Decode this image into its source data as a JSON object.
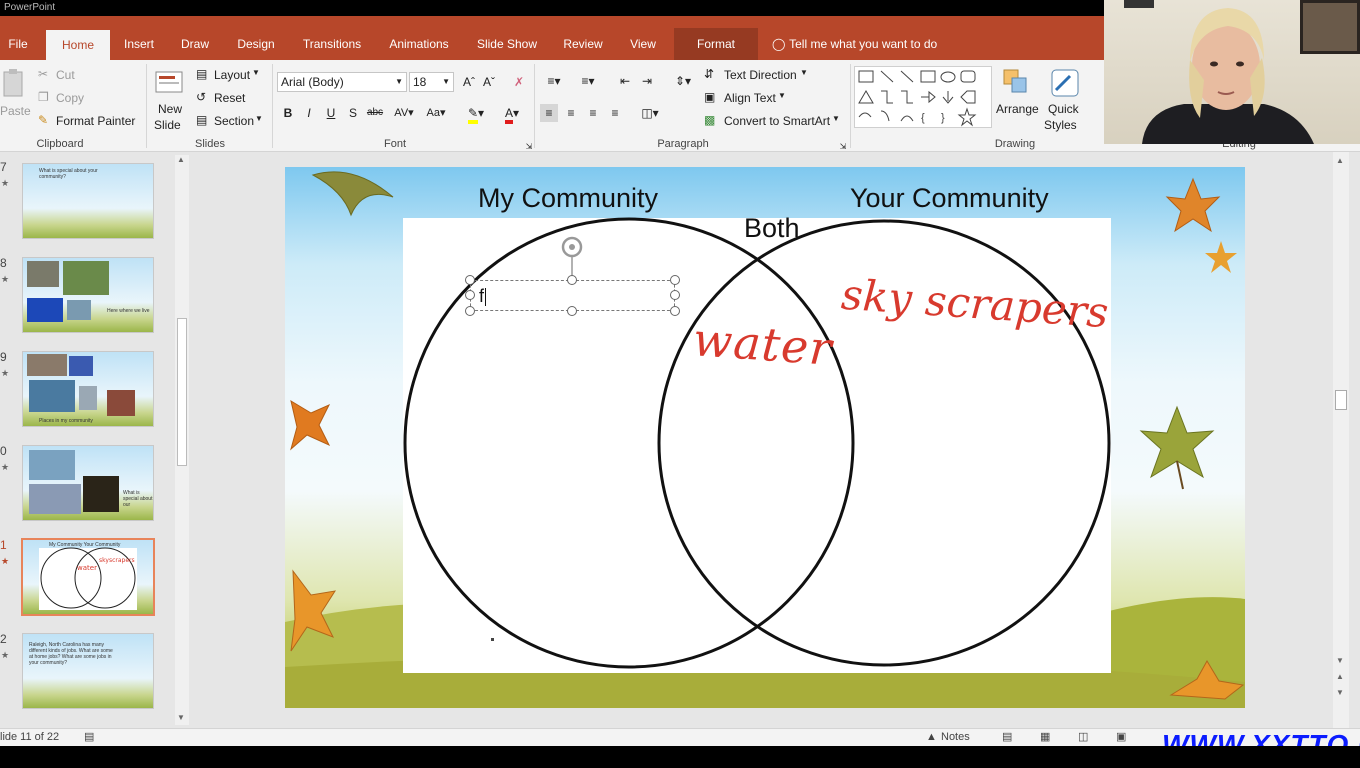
{
  "window": {
    "title_fragment": "PowerPoint"
  },
  "tabs": [
    {
      "label": "File"
    },
    {
      "label": "Home"
    },
    {
      "label": "Insert"
    },
    {
      "label": "Draw"
    },
    {
      "label": "Design"
    },
    {
      "label": "Transitions"
    },
    {
      "label": "Animations"
    },
    {
      "label": "Slide Show"
    },
    {
      "label": "Review"
    },
    {
      "label": "View"
    },
    {
      "label": "Format"
    }
  ],
  "tell_me": "Tell me what you want to do",
  "ribbon": {
    "clipboard": {
      "paste": "Paste",
      "cut": "Cut",
      "copy": "Copy",
      "format_painter": "Format Painter",
      "group": "Clipboard"
    },
    "slides": {
      "new_slide": "New",
      "new_slide2": "Slide",
      "layout": "Layout",
      "reset": "Reset",
      "section": "Section",
      "group": "Slides"
    },
    "font": {
      "family": "Arial (Body)",
      "size": "18",
      "group": "Font"
    },
    "paragraph": {
      "text_direction": "Text Direction",
      "align_text": "Align Text",
      "convert_smartart": "Convert to SmartArt",
      "group": "Paragraph"
    },
    "drawing": {
      "arrange": "Arrange",
      "quick_styles": "Quick",
      "quick_styles2": "Styles",
      "group": "Drawing"
    },
    "editing": {
      "group": "Editing"
    }
  },
  "thumbnails": [
    {
      "num": "7",
      "text": "What is special about your community?"
    },
    {
      "num": "8",
      "text": "Here where we live"
    },
    {
      "num": "9",
      "text": "Places in my community"
    },
    {
      "num": "0",
      "text": "What is special about our"
    },
    {
      "num": "1",
      "text": "My Community   Your Community"
    },
    {
      "num": "2",
      "text": "Raleigh, North Carolina has many different kinds of jobs. What are some at home jobs? What are some jobs in your community?"
    }
  ],
  "slide": {
    "heading_left": "My Community",
    "heading_right": "Your Community",
    "heading_center": "Both",
    "textbox_value": "f",
    "ink_center": "water",
    "ink_right": "sky scrapers"
  },
  "status": {
    "slide_of": "lide 11 of 22",
    "notes": "Notes"
  },
  "watermark": "WWW.XXTTQ.COM",
  "colors": {
    "accent": "#b7472a",
    "ink": "#d83a2e",
    "selection": "#e8845a",
    "watermark": "#0b1cff"
  }
}
